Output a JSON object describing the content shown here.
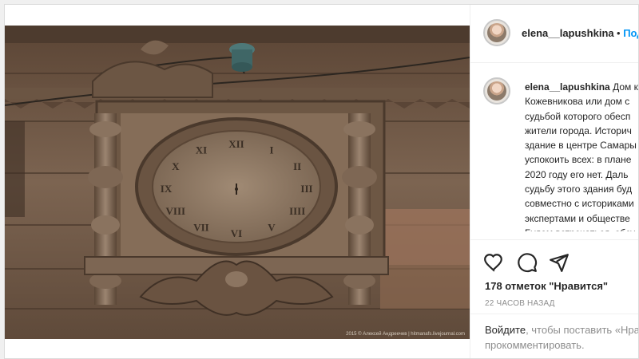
{
  "post": {
    "photo_alt": "Старинные деревянные часы на фасаде дома",
    "watermark": "2015 © Алексей Андреечев | hitmanafs.livejournal.com",
    "clock_numerals": [
      "XII",
      "I",
      "II",
      "III",
      "IIII",
      "V",
      "VI",
      "VII",
      "VIII",
      "IX",
      "X",
      "XI"
    ]
  },
  "header": {
    "username": "elena__lapushkina",
    "separator": "•",
    "follow_label": "Подп"
  },
  "caption": {
    "author": "elena__lapushkina",
    "text": "Дом к\nКожевникова или дом с\nсудьбой которого обесп\nжители города. Историч\nздание в центре Самары\nуспокоить всех: в плане\n2020 году его нет. Даль\nсудьбу этого здания буд\nсовместно с историками\nэкспертами и обществе\nБудем встречаться, обсу"
  },
  "actions": {
    "like_icon": "heart-icon",
    "comment_icon": "comment-icon",
    "share_icon": "send-icon",
    "likes_text": "178 отметок \"Нравится\"",
    "time_text": "22 ЧАСОВ НАЗАД"
  },
  "login": {
    "link_label": "Войдите",
    "rest_line1": ", чтобы поставить «Нра",
    "line2": "прокомментировать."
  }
}
